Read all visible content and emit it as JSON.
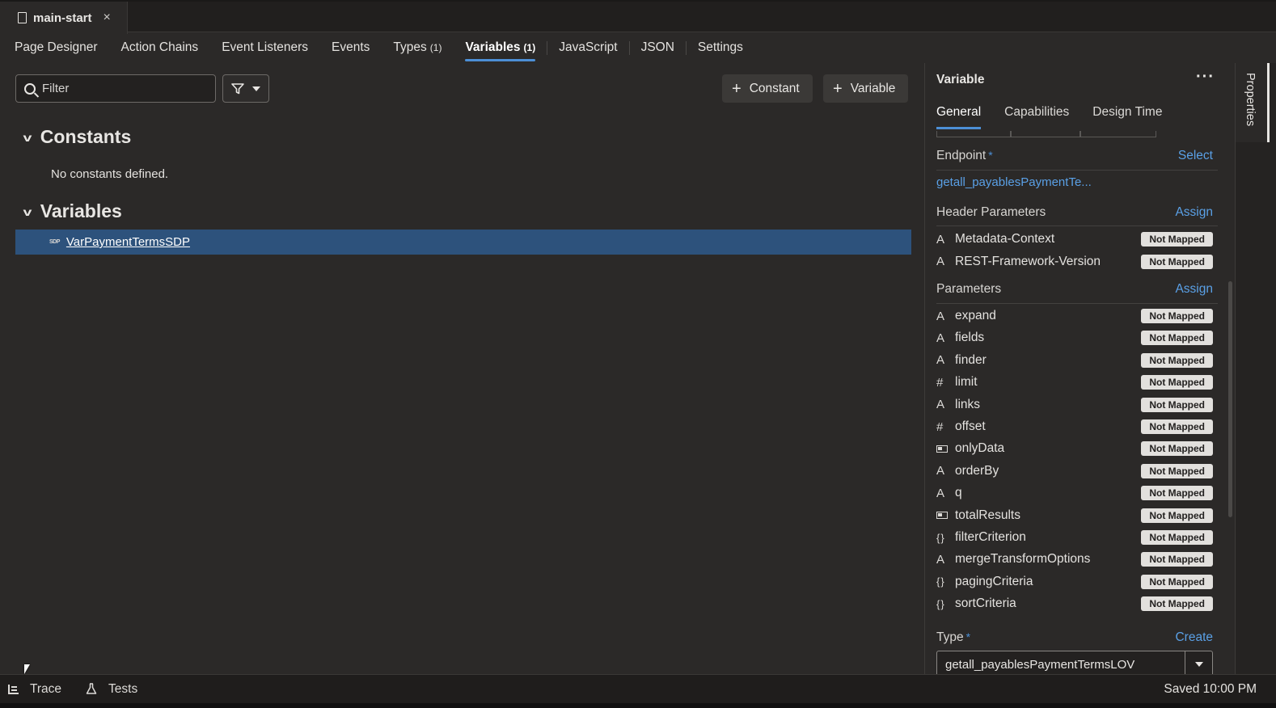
{
  "file_tab": {
    "title": "main-start",
    "close_glyph": "×"
  },
  "designer_tabs": [
    {
      "label": "Page Designer",
      "count": ""
    },
    {
      "label": "Action Chains",
      "count": ""
    },
    {
      "label": "Event Listeners",
      "count": ""
    },
    {
      "label": "Events",
      "count": ""
    },
    {
      "label": "Types",
      "count": "(1)"
    },
    {
      "label": "Variables",
      "count": "(1)",
      "active": true
    },
    {
      "label": "JavaScript",
      "count": ""
    },
    {
      "label": "JSON",
      "count": ""
    },
    {
      "label": "Settings",
      "count": ""
    }
  ],
  "toolbar": {
    "filter_placeholder": "Filter",
    "add_constant_label": "Constant",
    "add_variable_label": "Variable"
  },
  "constants": {
    "heading": "Constants",
    "empty_message": "No constants defined."
  },
  "variables": {
    "heading": "Variables",
    "items": [
      {
        "icon": "SDP",
        "name": "VarPaymentTermsSDP"
      }
    ]
  },
  "properties": {
    "title": "Variable",
    "more_glyph": "···",
    "tabs": [
      "General",
      "Capabilities",
      "Design Time"
    ],
    "endpoint": {
      "label": "Endpoint",
      "required": "*",
      "action": "Select",
      "value": "getall_payablesPaymentTe..."
    },
    "header_parameters": {
      "label": "Header Parameters",
      "action": "Assign",
      "items": [
        {
          "type": "A",
          "name": "Metadata-Context",
          "status": "Not Mapped"
        },
        {
          "type": "A",
          "name": "REST-Framework-Version",
          "status": "Not Mapped"
        }
      ]
    },
    "parameters": {
      "label": "Parameters",
      "action": "Assign",
      "items": [
        {
          "type": "A",
          "name": "expand",
          "status": "Not Mapped"
        },
        {
          "type": "A",
          "name": "fields",
          "status": "Not Mapped"
        },
        {
          "type": "A",
          "name": "finder",
          "status": "Not Mapped"
        },
        {
          "type": "#",
          "name": "limit",
          "status": "Not Mapped"
        },
        {
          "type": "A",
          "name": "links",
          "status": "Not Mapped"
        },
        {
          "type": "#",
          "name": "offset",
          "status": "Not Mapped"
        },
        {
          "type": "bool",
          "name": "onlyData",
          "status": "Not Mapped"
        },
        {
          "type": "A",
          "name": "orderBy",
          "status": "Not Mapped"
        },
        {
          "type": "A",
          "name": "q",
          "status": "Not Mapped"
        },
        {
          "type": "bool",
          "name": "totalResults",
          "status": "Not Mapped"
        },
        {
          "type": "{}",
          "name": "filterCriterion",
          "status": "Not Mapped"
        },
        {
          "type": "A",
          "name": "mergeTransformOptions",
          "status": "Not Mapped"
        },
        {
          "type": "{}",
          "name": "pagingCriteria",
          "status": "Not Mapped"
        },
        {
          "type": "{}",
          "name": "sortCriteria",
          "status": "Not Mapped"
        }
      ]
    },
    "type_field": {
      "label": "Type",
      "required": "*",
      "action": "Create",
      "value": "getall_payablesPaymentTermsLOV"
    },
    "side_tab": "Properties"
  },
  "statusbar": {
    "trace_label": "Trace",
    "tests_label": "Tests",
    "saved_text": "Saved 10:00 PM"
  },
  "colors": {
    "accent": "#4c8fd6",
    "link": "#5aa0e6",
    "selection": "#2d527c",
    "background": "#2b2928"
  }
}
